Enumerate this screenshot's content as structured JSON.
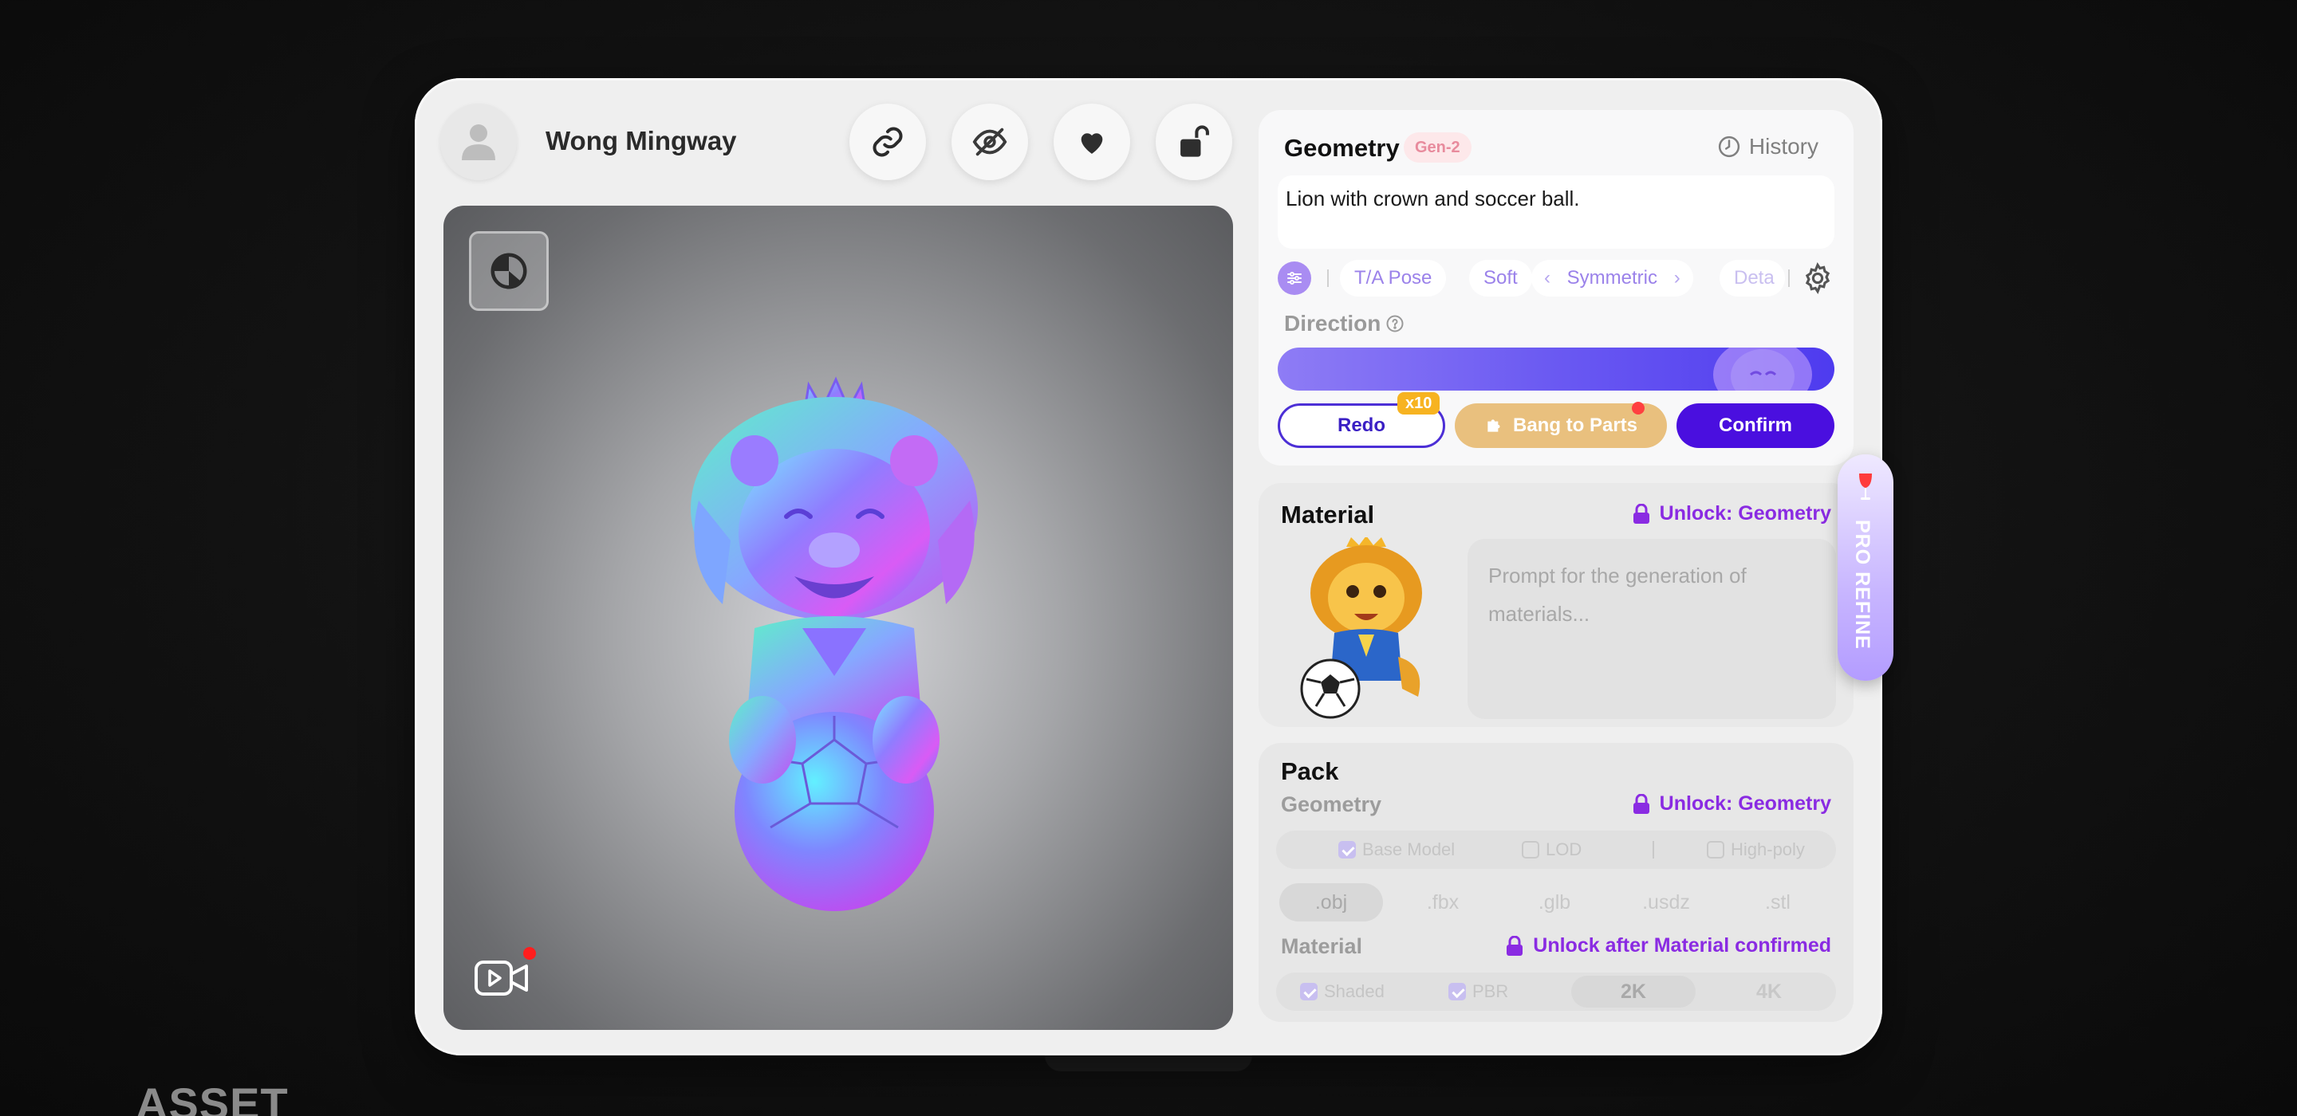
{
  "user": {
    "name": "Wong Mingway"
  },
  "toolbar": {
    "icons": [
      "link-icon",
      "hide-icon",
      "heart-icon",
      "unlock-icon"
    ]
  },
  "viewport": {
    "toggle_icon": "view-mode-icon",
    "record_icon": "video-record-icon"
  },
  "geometry": {
    "title": "Geometry",
    "badge": "Gen-2",
    "history_label": "History",
    "prompt": "Lion with crown and soccer ball.",
    "chips": [
      "T/A Pose",
      "Soft",
      "Symmetric",
      "Deta"
    ],
    "direction_label": "Direction",
    "redo_label": "Redo",
    "redo_multiplier": "x10",
    "bang_label": "Bang to Parts",
    "confirm_label": "Confirm"
  },
  "material": {
    "title": "Material",
    "unlock_label": "Unlock: Geometry",
    "prompt_placeholder": "Prompt for the generation of materials..."
  },
  "pack": {
    "title": "Pack",
    "geometry_label": "Geometry",
    "geometry_unlock": "Unlock: Geometry",
    "geometry_options": [
      {
        "label": "Base Model",
        "checked": true
      },
      {
        "label": "LOD",
        "checked": false
      },
      {
        "label": "High-poly",
        "checked": false
      }
    ],
    "formats": [
      ".obj",
      ".fbx",
      ".glb",
      ".usdz",
      ".stl"
    ],
    "selected_format": ".obj",
    "material_label": "Material",
    "material_unlock": "Unlock after Material confirmed",
    "material_options": [
      {
        "label": "Shaded",
        "checked": true
      },
      {
        "label": "PBR",
        "checked": true
      }
    ],
    "resolutions": [
      "2K",
      "4K"
    ],
    "selected_resolution": "2K"
  },
  "pro_refine": {
    "label": "PRO REFINE"
  },
  "footer": {
    "section_label": "ASSET"
  },
  "colors": {
    "accent": "#4a0fdf",
    "unlock": "#8a2be2",
    "bang": "#e9c07e",
    "badge_bg": "#fde8ea"
  }
}
